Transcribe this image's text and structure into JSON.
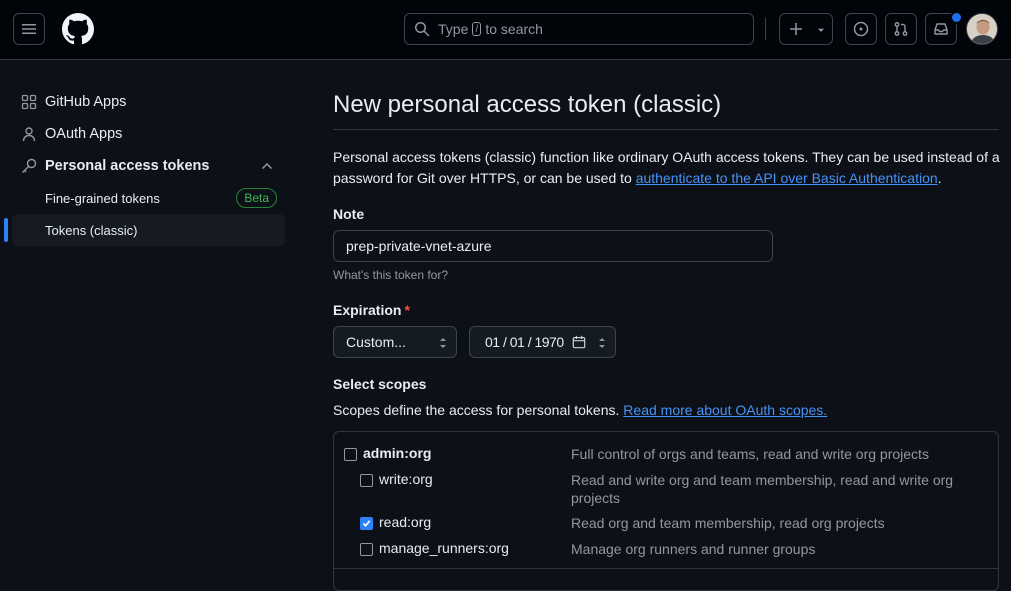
{
  "header": {
    "search_prefix": "Type",
    "search_slash": "/",
    "search_suffix": "to search",
    "colors": {
      "background": "#010409",
      "notification_dot": "#1f6feb"
    },
    "icons": [
      "menu-icon",
      "github-logo-icon",
      "search-icon",
      "plus-icon",
      "chevron-down-icon",
      "issues-icon",
      "pull-requests-icon",
      "inbox-icon"
    ]
  },
  "sidebar": {
    "items": [
      {
        "label": "GitHub Apps",
        "icon": "apps-grid-icon"
      },
      {
        "label": "OAuth Apps",
        "icon": "person-icon"
      },
      {
        "label": "Personal access tokens",
        "icon": "key-icon",
        "expanded": true
      }
    ],
    "subitems": [
      {
        "label": "Fine-grained tokens",
        "badge": "Beta"
      },
      {
        "label": "Tokens (classic)",
        "active": true
      }
    ]
  },
  "main": {
    "title": "New personal access token (classic)",
    "description_prefix": "Personal access tokens (classic) function like ordinary OAuth access tokens. They can be used instead of a password for Git over HTTPS, or can be used to ",
    "description_link": "authenticate to the API over Basic Authentication",
    "description_suffix": ".",
    "note": {
      "label": "Note",
      "value": "prep-private-vnet-azure",
      "hint": "What's this token for?"
    },
    "expiration": {
      "label": "Expiration",
      "required_marker": "*",
      "selected": "Custom...",
      "date": "01 / 01 / 1970"
    },
    "scopes": {
      "label": "Select scopes",
      "description": "Scopes define the access for personal tokens.",
      "link": "Read more about OAuth scopes.",
      "items": [
        {
          "name": "admin:org",
          "description": "Full control of orgs and teams, read and write org projects",
          "checked": false,
          "parent": true
        },
        {
          "name": "write:org",
          "description": "Read and write org and team membership, read and write org projects",
          "checked": false,
          "parent": false
        },
        {
          "name": "read:org",
          "description": "Read org and team membership, read org projects",
          "checked": true,
          "parent": false
        },
        {
          "name": "manage_runners:org",
          "description": "Manage org runners and runner groups",
          "checked": false,
          "parent": false
        }
      ]
    }
  }
}
